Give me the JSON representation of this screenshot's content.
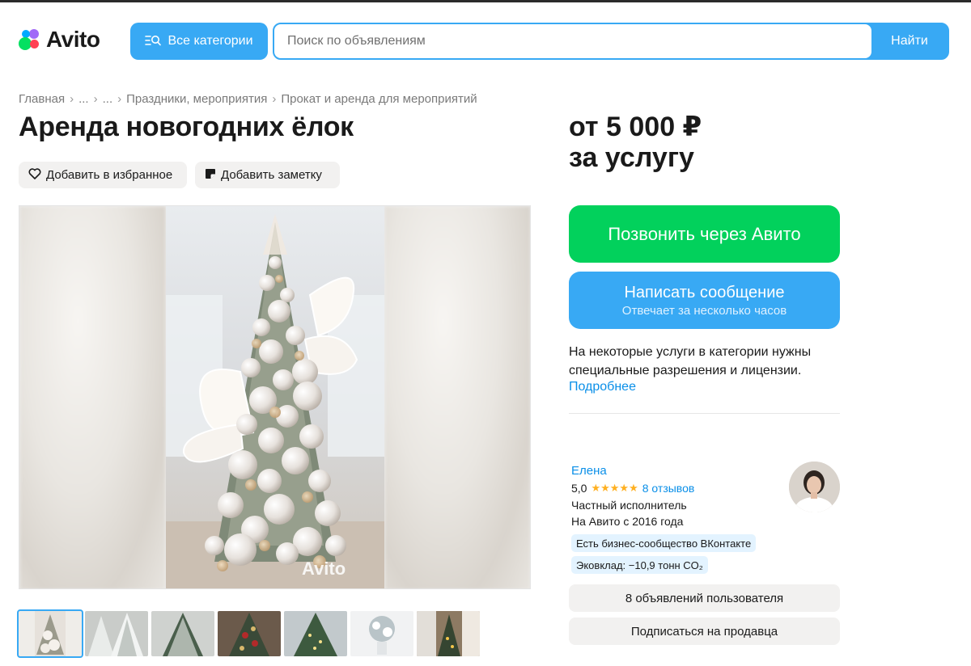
{
  "header": {
    "logo_text": "Avito",
    "categories_button": "Все категории",
    "search_placeholder": "Поиск по объявлениям",
    "search_button": "Найти"
  },
  "breadcrumb": [
    "Главная",
    "...",
    "...",
    "Праздники, мероприятия",
    "Прокат и аренда для мероприятий"
  ],
  "listing": {
    "title": "Аренда новогодних ёлок",
    "add_favorite": "Добавить в избранное",
    "add_note": "Добавить заметку",
    "watermark": "Avito",
    "thumbnail_count": 7,
    "active_thumbnail": 1
  },
  "sidebar": {
    "price_line1": "от 5 000 ₽",
    "price_line2": "за услугу",
    "call_button": "Позвонить через Авито",
    "message_button": "Написать сообщение",
    "message_sub": "Отвечает за несколько часов",
    "notice": "На некоторые услуги в категории нужны специальные разрешения и лицензии.",
    "more_link": "Подробнее"
  },
  "seller": {
    "name": "Елена",
    "rating": "5,0",
    "stars": "★★★★★",
    "reviews": "8 отзывов",
    "type": "Частный исполнитель",
    "since": "На Авито с 2016 года",
    "badge_vk": "Есть бизнес-сообщество ВКонтакте",
    "badge_eco": "Эковклад: −10,9 тонн CO₂",
    "listings_button": "8 объявлений пользователя",
    "subscribe_button": "Подписаться на продавца"
  },
  "colors": {
    "accent_blue": "#38a9f4",
    "call_green": "#02d15c",
    "link_blue": "#0a8fe8",
    "star_yellow": "#ffb021"
  }
}
